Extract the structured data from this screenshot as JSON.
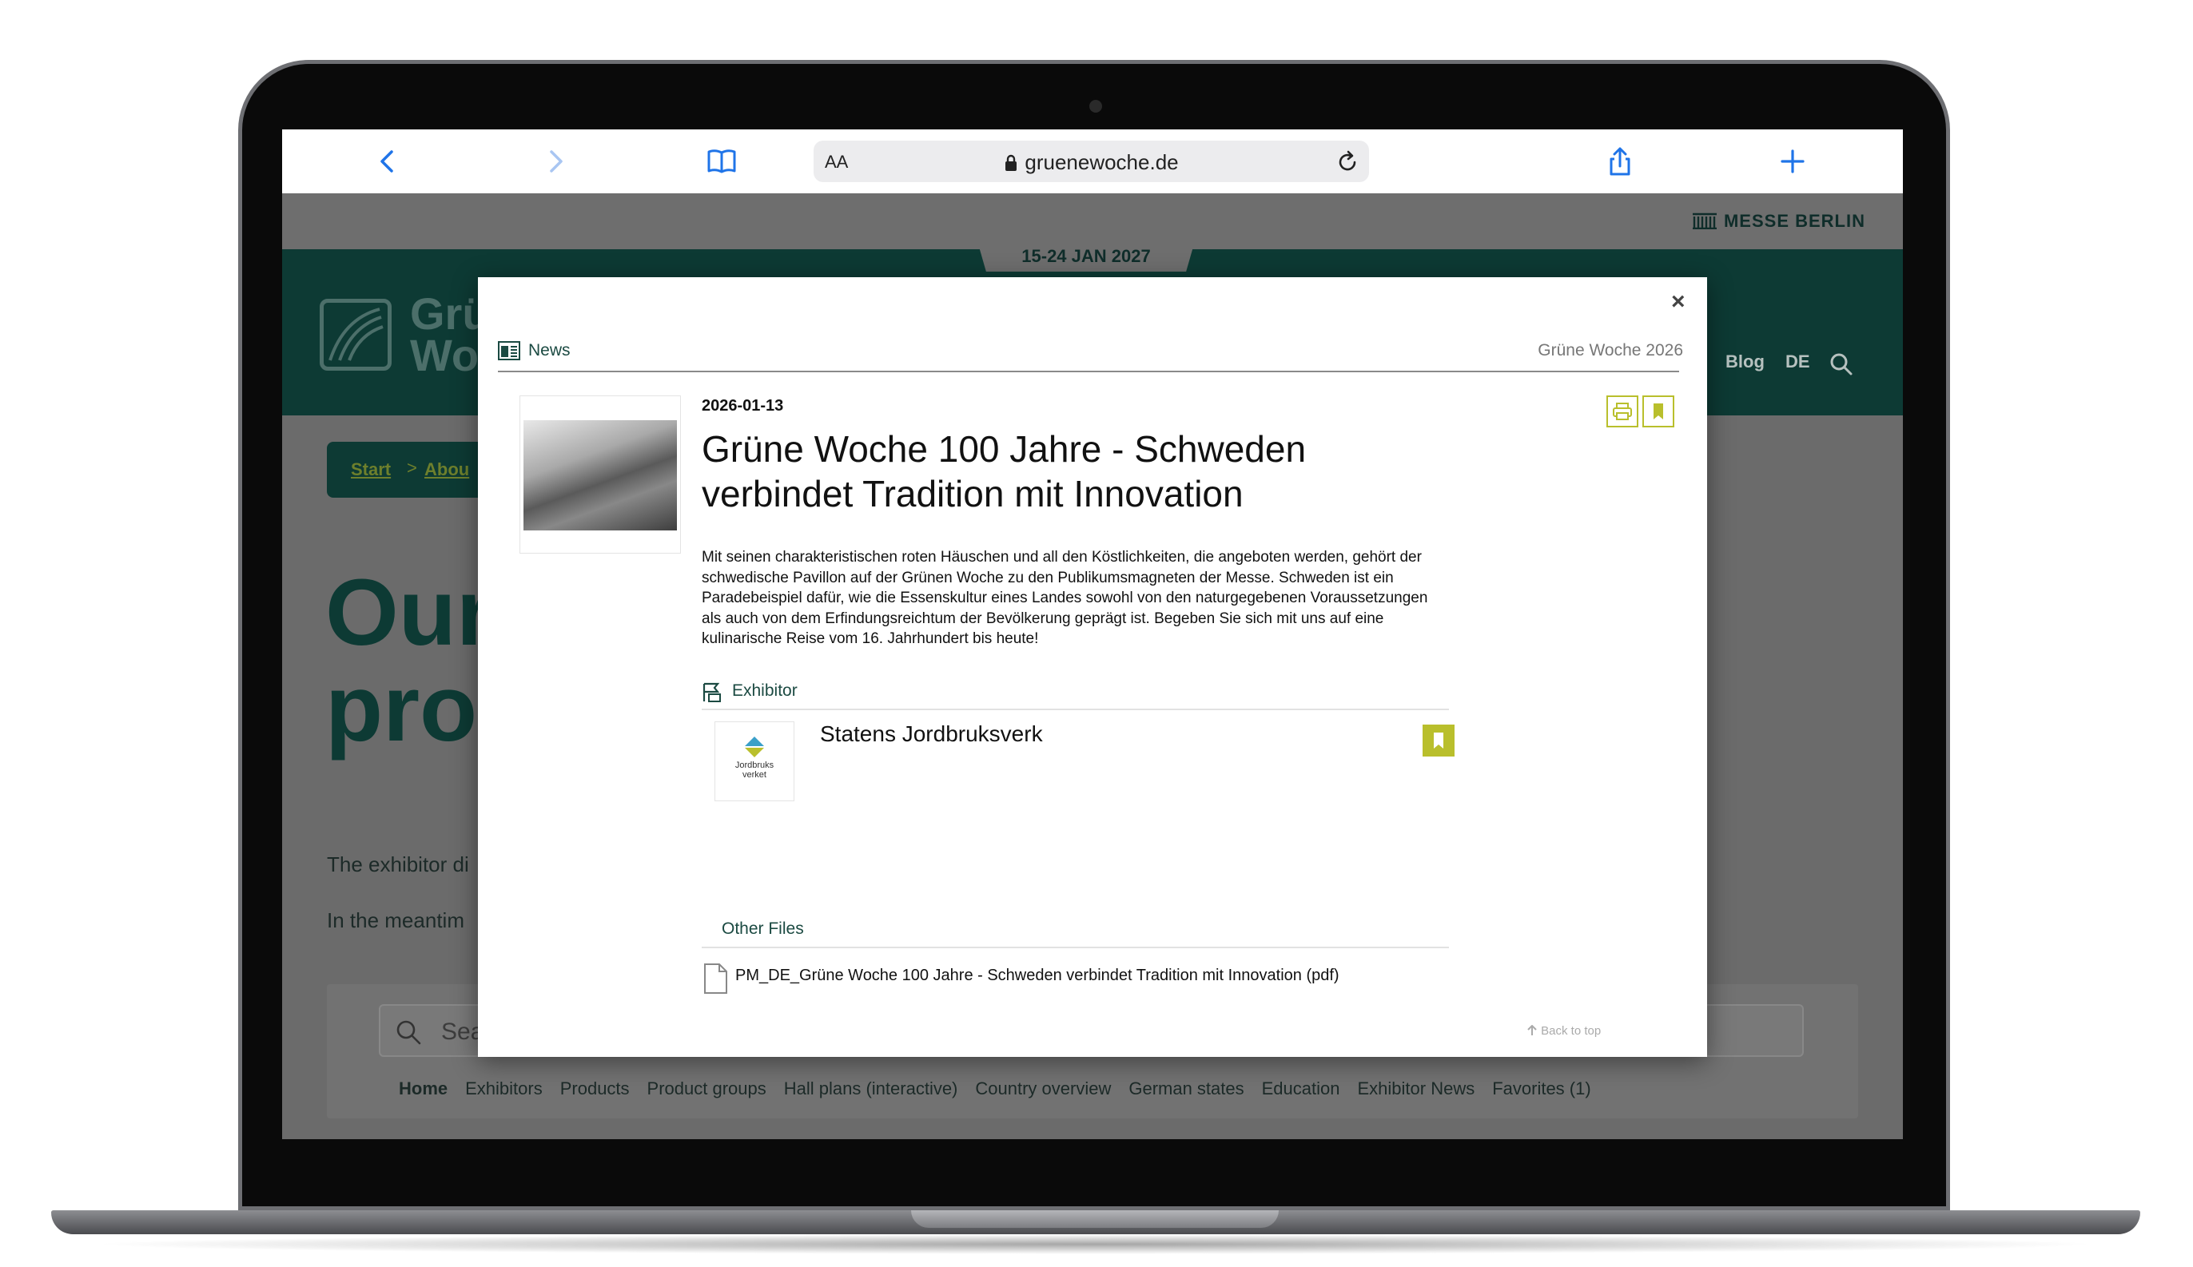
{
  "browser": {
    "aa_label": "AA",
    "url": "gruenewoche.de"
  },
  "site": {
    "brand": "MESSE BERLIN",
    "event_dates": "15-24 JAN 2027",
    "logo_text": "Grü\nWo",
    "nav": {
      "blog": "Blog",
      "language": "DE"
    },
    "breadcrumb": {
      "start": "Start",
      "separator": ">",
      "about": "Abou"
    },
    "hero": "Our\npro",
    "body_line1": "The exhibitor di",
    "body_line2": "In the meantim",
    "search_placeholder": "Sea",
    "tabs": [
      "Home",
      "Exhibitors",
      "Products",
      "Product groups",
      "Hall plans (interactive)",
      "Country overview",
      "German states",
      "Education",
      "Exhibitor News",
      "Favorites (1)"
    ]
  },
  "modal": {
    "close_label": "×",
    "section_label": "News",
    "event_label": "Grüne Woche 2026",
    "date": "2026-01-13",
    "title": "Grüne Woche 100 Jahre - Schweden verbindet Tradition mit Innovation",
    "body": "Mit seinen charakteristischen roten Häuschen und all den Köstlichkeiten, die angeboten werden, gehört der schwedische Pavillon auf der Grünen Woche zu den Publikumsmagneten der Messe. Schweden ist ein Paradebeispiel dafür, wie die Essenskultur eines Landes sowohl von den naturgegebenen Voraussetzungen als auch von dem Erfindungsreichtum der Bevölkerung geprägt ist. Begeben Sie sich mit uns auf eine kulinarische Reise vom 16. Jahrhundert bis heute!",
    "exhibitor_label": "Exhibitor",
    "exhibitor_name": "Statens Jordbruksverk",
    "exhibitor_logo_text": "Jordbruks\nverket",
    "files_label": "Other Files",
    "file_name": "PM_DE_Grüne Woche 100 Jahre - Schweden verbindet Tradition mit Innovation (pdf)",
    "back_to_top": "Back to top"
  },
  "colors": {
    "accent_green": "#b9bf2c",
    "dark_teal": "#0d3a34",
    "browser_blue": "#1f74e8"
  }
}
